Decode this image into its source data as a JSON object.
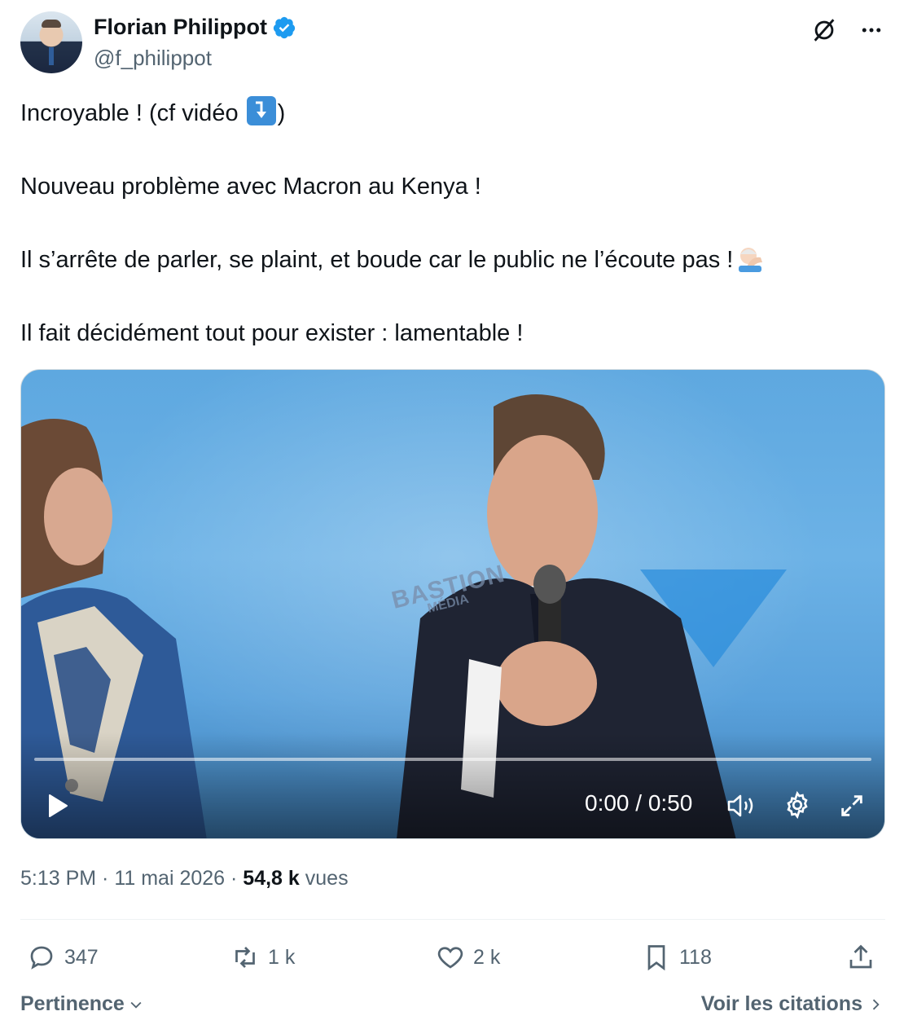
{
  "author": {
    "name": "Florian Philippot",
    "handle": "@f_philippot",
    "verified": true,
    "avatar_icon": "profile-photo"
  },
  "tweet": {
    "line1_text": "Incroyable ! (cf vidéo ",
    "line1_close": ")",
    "line1_emoji": "arrow-down-right-emoji",
    "line2": "Nouveau problème avec Macron au Kenya !",
    "line3": "Il s’arrête de parler, se plaint, et boude car le public ne l’écoute pas !",
    "line3_emoji": "facepalm-emoji",
    "line4": "Il fait décidément tout pour exister : lamentable !"
  },
  "video": {
    "watermark_main": "BASTION",
    "watermark_sub": "MÉDIA",
    "time": "0:00 / 0:50",
    "progress": 0
  },
  "meta": {
    "time": "5:13 PM",
    "sep1": " · ",
    "date": "11 mai 2026",
    "sep2": " · ",
    "views_count": "54,8 k",
    "views_label": " vues"
  },
  "actions": {
    "replies": "347",
    "reposts": "1 k",
    "likes": "2 k",
    "bookmarks": "118"
  },
  "footer": {
    "sort_label": "Pertinence",
    "quotes_label": "Voir les citations"
  },
  "colors": {
    "text_primary": "#0f1419",
    "text_secondary": "#536471",
    "verified_blue": "#1d9bf0",
    "divider": "#eff3f4"
  }
}
